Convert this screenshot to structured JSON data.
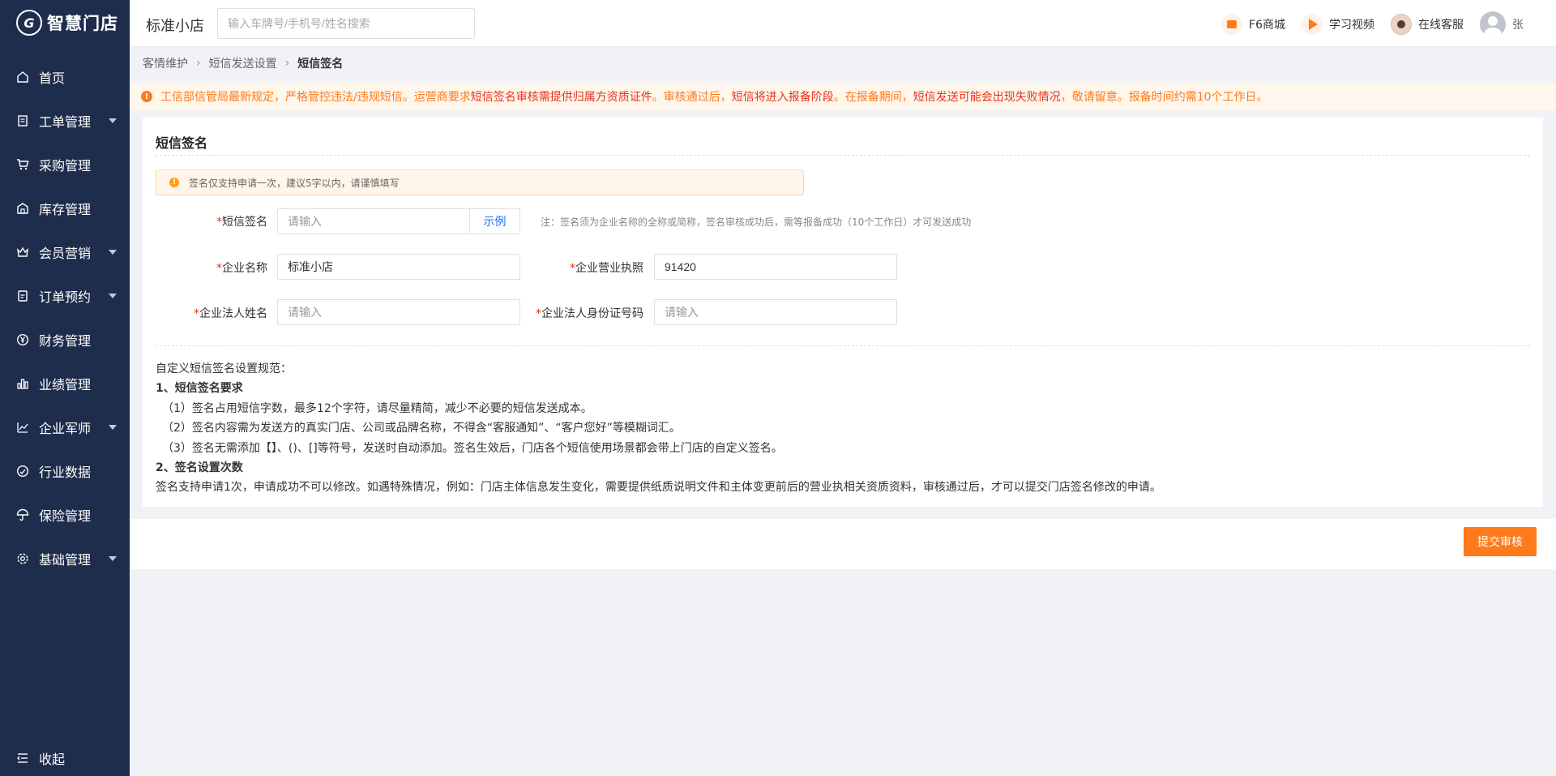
{
  "brand": {
    "mark": "G",
    "name": "智慧门店"
  },
  "sidebar": {
    "items": [
      {
        "label": "首页",
        "icon": "home-icon",
        "expandable": false
      },
      {
        "label": "工单管理",
        "icon": "document-icon",
        "expandable": true
      },
      {
        "label": "采购管理",
        "icon": "cart-icon",
        "expandable": false
      },
      {
        "label": "库存管理",
        "icon": "warehouse-icon",
        "expandable": false
      },
      {
        "label": "会员营销",
        "icon": "crown-icon",
        "expandable": true
      },
      {
        "label": "订单预约",
        "icon": "order-icon",
        "expandable": true
      },
      {
        "label": "财务管理",
        "icon": "yen-icon",
        "expandable": false
      },
      {
        "label": "业绩管理",
        "icon": "bar-chart-icon",
        "expandable": false
      },
      {
        "label": "企业军师",
        "icon": "line-chart-icon",
        "expandable": true
      },
      {
        "label": "行业数据",
        "icon": "gauge-icon",
        "expandable": false
      },
      {
        "label": "保险管理",
        "icon": "umbrella-icon",
        "expandable": false
      },
      {
        "label": "基础管理",
        "icon": "gear-icon",
        "expandable": true
      }
    ],
    "collapse_label": "收起"
  },
  "topbar": {
    "store_name": "标准小店",
    "search_placeholder": "输入车牌号/手机号/姓名搜索",
    "mall_label": "F6商城",
    "video_label": "学习视频",
    "service_label": "在线客服",
    "user_name": "张"
  },
  "breadcrumb": [
    "客情维护",
    "短信发送设置",
    "短信签名"
  ],
  "notice": {
    "part1": "工信部信管局最新规定，严格管控违法/违规短信。运营商要求",
    "part2": "短信签名审核需提供归属方资质证件",
    "part3": "。审核通过后，",
    "part4": "短信将进入报备阶段",
    "part5": "。在报备期间，",
    "part6": "短信发送可能会出现失败情况",
    "part7": "，敬请留意。报备时间约需10个工作日。"
  },
  "card": {
    "title": "短信签名",
    "tip": "签名仅支持申请一次，建议5字以内，请谨慎填写",
    "form": {
      "signature_label": "短信签名",
      "signature_placeholder": "请输入",
      "example_label": "示例",
      "note": "注：签名须为企业名称的全称或简称，签名审核成功后，需等报备成功（10个工作日）才可发送成功",
      "company_label": "企业名称",
      "company_value": "标准小店",
      "license_label": "企业营业执照",
      "license_value": "91420",
      "legal_name_label": "企业法人姓名",
      "legal_name_placeholder": "请输入",
      "legal_id_label": "企业法人身份证号码",
      "legal_id_placeholder": "请输入"
    },
    "rules": {
      "intro": "自定义短信签名设置规范：",
      "h1": "1、短信签名要求",
      "r1": "（1）签名占用短信字数，最多12个字符，请尽量精简，减少不必要的短信发送成本。",
      "r2": "（2）签名内容需为发送方的真实门店、公司或品牌名称，不得含“客服通知”、“客户您好”等模糊词汇。",
      "r3": "（3）签名无需添加【】、()、[]等符号，发送时自动添加。签名生效后，门店各个短信使用场景都会带上门店的自定义签名。",
      "h2": "2、签名设置次数",
      "r4": "签名支持申请1次，申请成功不可以修改。如遇特殊情况，例如：门店主体信息发生变化，需要提供纸质说明文件和主体变更前后的营业执相关资质资料，审核通过后，才可以提交门店签名修改的申请。"
    }
  },
  "submit_label": "提交审核",
  "colors": {
    "sidebar": "#1f2d4d",
    "accent": "#ff7a1a",
    "warning_red": "#e8331a",
    "link": "#1a6dff"
  }
}
